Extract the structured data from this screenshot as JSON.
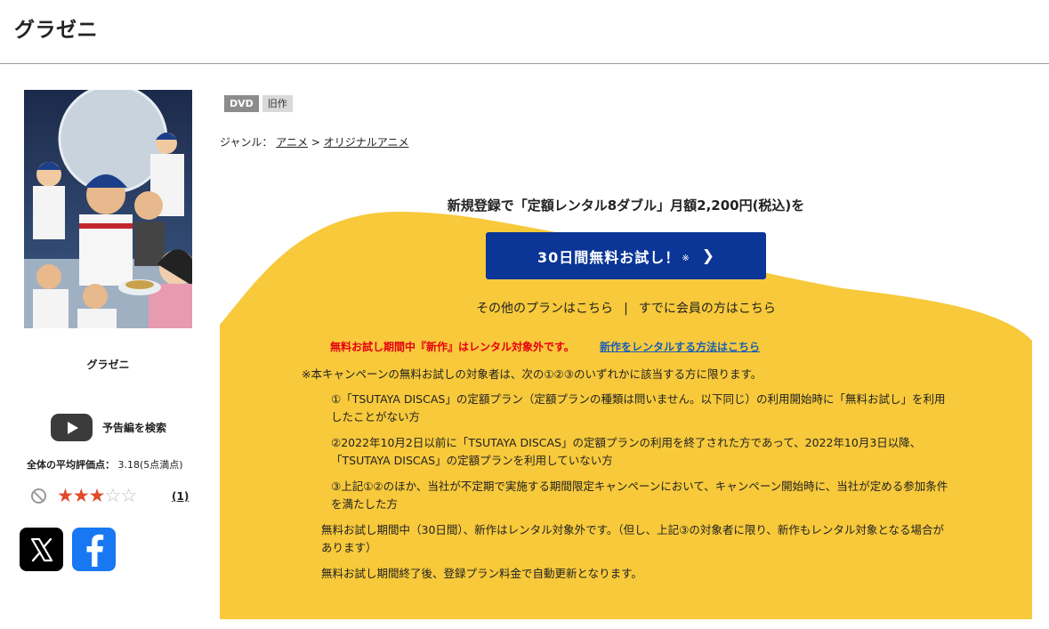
{
  "page": {
    "title": "グラゼニ"
  },
  "cover": {
    "caption": "グラゼニ"
  },
  "trailer": {
    "label": "予告編を検索"
  },
  "rating": {
    "label": "全体の平均評価点：",
    "value": "3.18(5点満点)",
    "stars_filled": 3,
    "stars_total": 5,
    "review_count": "(1)"
  },
  "social": [
    "x-icon",
    "facebook-icon"
  ],
  "tags": [
    "DVD",
    "旧作"
  ],
  "genre": {
    "label": "ジャンル：",
    "crumbs": [
      "アニメ",
      "オリジナルアニメ"
    ],
    "separator": ">"
  },
  "promo": {
    "heading": "新規登録で「定額レンタル8ダブル」月額2,200円(税込)を",
    "cta_label": "30日間無料お試し！",
    "cta_note": "※",
    "other_plans": "その他のプランはこちら",
    "separator": "|",
    "members": "すでに会員の方はこちら",
    "notice_red": "無料お試し期間中『新作』はレンタル対象外です。",
    "notice_link": "新作をレンタルする方法はこちら",
    "conditions_heading": "※本キャンペーンの無料お試しの対象者は、次の①②③のいずれかに該当する方に限ります。",
    "conditions": [
      "①「TSUTAYA DISCAS」の定額プラン（定額プランの種類は問いません。以下同じ）の利用開始時に「無料お試し」を利用したことがない方",
      "②2022年10月2日以前に「TSUTAYA DISCAS」の定額プランの利用を終了された方であって、2022年10月3日以降、「TSUTAYA DISCAS」の定額プランを利用していない方",
      "③上記①②のほか、当社が不定期で実施する期間限定キャンペーンにおいて、キャンペーン開始時に、当社が定める参加条件を満たした方"
    ],
    "note_1": "無料お試し期間中（30日間）、新作はレンタル対象外です。（但し、上記③の対象者に限り、新作もレンタル対象となる場合があります）",
    "note_2": "無料お試し期間終了後、登録プラン料金で自動更新となります。"
  },
  "colors": {
    "panel_yellow": "#f7c93b",
    "cta_blue": "#0b3596",
    "star_red": "#e04a2a",
    "notice_red": "#e60012",
    "link_blue": "#1a5fb4"
  }
}
